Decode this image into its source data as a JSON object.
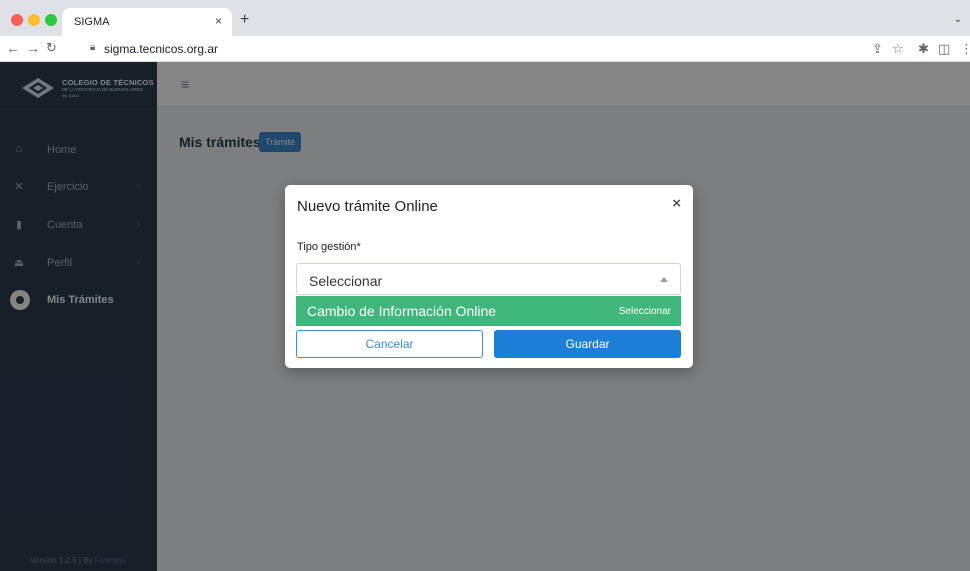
{
  "browser": {
    "tab_title": "SIGMA",
    "tab_close": "×",
    "new_tab": "+",
    "url": "sigma.tecnicos.org.ar"
  },
  "logo": {
    "title": "COLEGIO DE TÉCNICOS",
    "subtitle": "DE LA PROVINCIA DE BUENOS AIRES",
    "law": "ley 10411"
  },
  "sidebar": {
    "items": [
      {
        "label": "Home",
        "icon": "home-icon"
      },
      {
        "label": "Ejercicio",
        "icon": "tools-icon",
        "chevron": "›"
      },
      {
        "label": "Cuenta",
        "icon": "document-icon",
        "chevron": "›"
      },
      {
        "label": "Perfil",
        "icon": "user-icon",
        "chevron": "›"
      },
      {
        "label": "Mis Trámites",
        "icon": "circle-icon",
        "active": true
      }
    ],
    "version": "Versión 1.2.5 | By",
    "version_link": "Fiverage"
  },
  "main": {
    "title": "Mis trámites",
    "tramite_button": "Trámite"
  },
  "modal": {
    "title": "Nuevo trámite Online",
    "close": "×",
    "field_label": "Tipo gestión*",
    "select_value": "Seleccionar",
    "option_label": "Cambio de Información Online",
    "option_hint": "Seleccionar",
    "cancel_label": "Cancelar",
    "save_label": "Guardar"
  },
  "colors": {
    "sidebar_bg": "#2c3e50",
    "primary": "#1b7fd6",
    "option_bg": "#3fb67a"
  }
}
